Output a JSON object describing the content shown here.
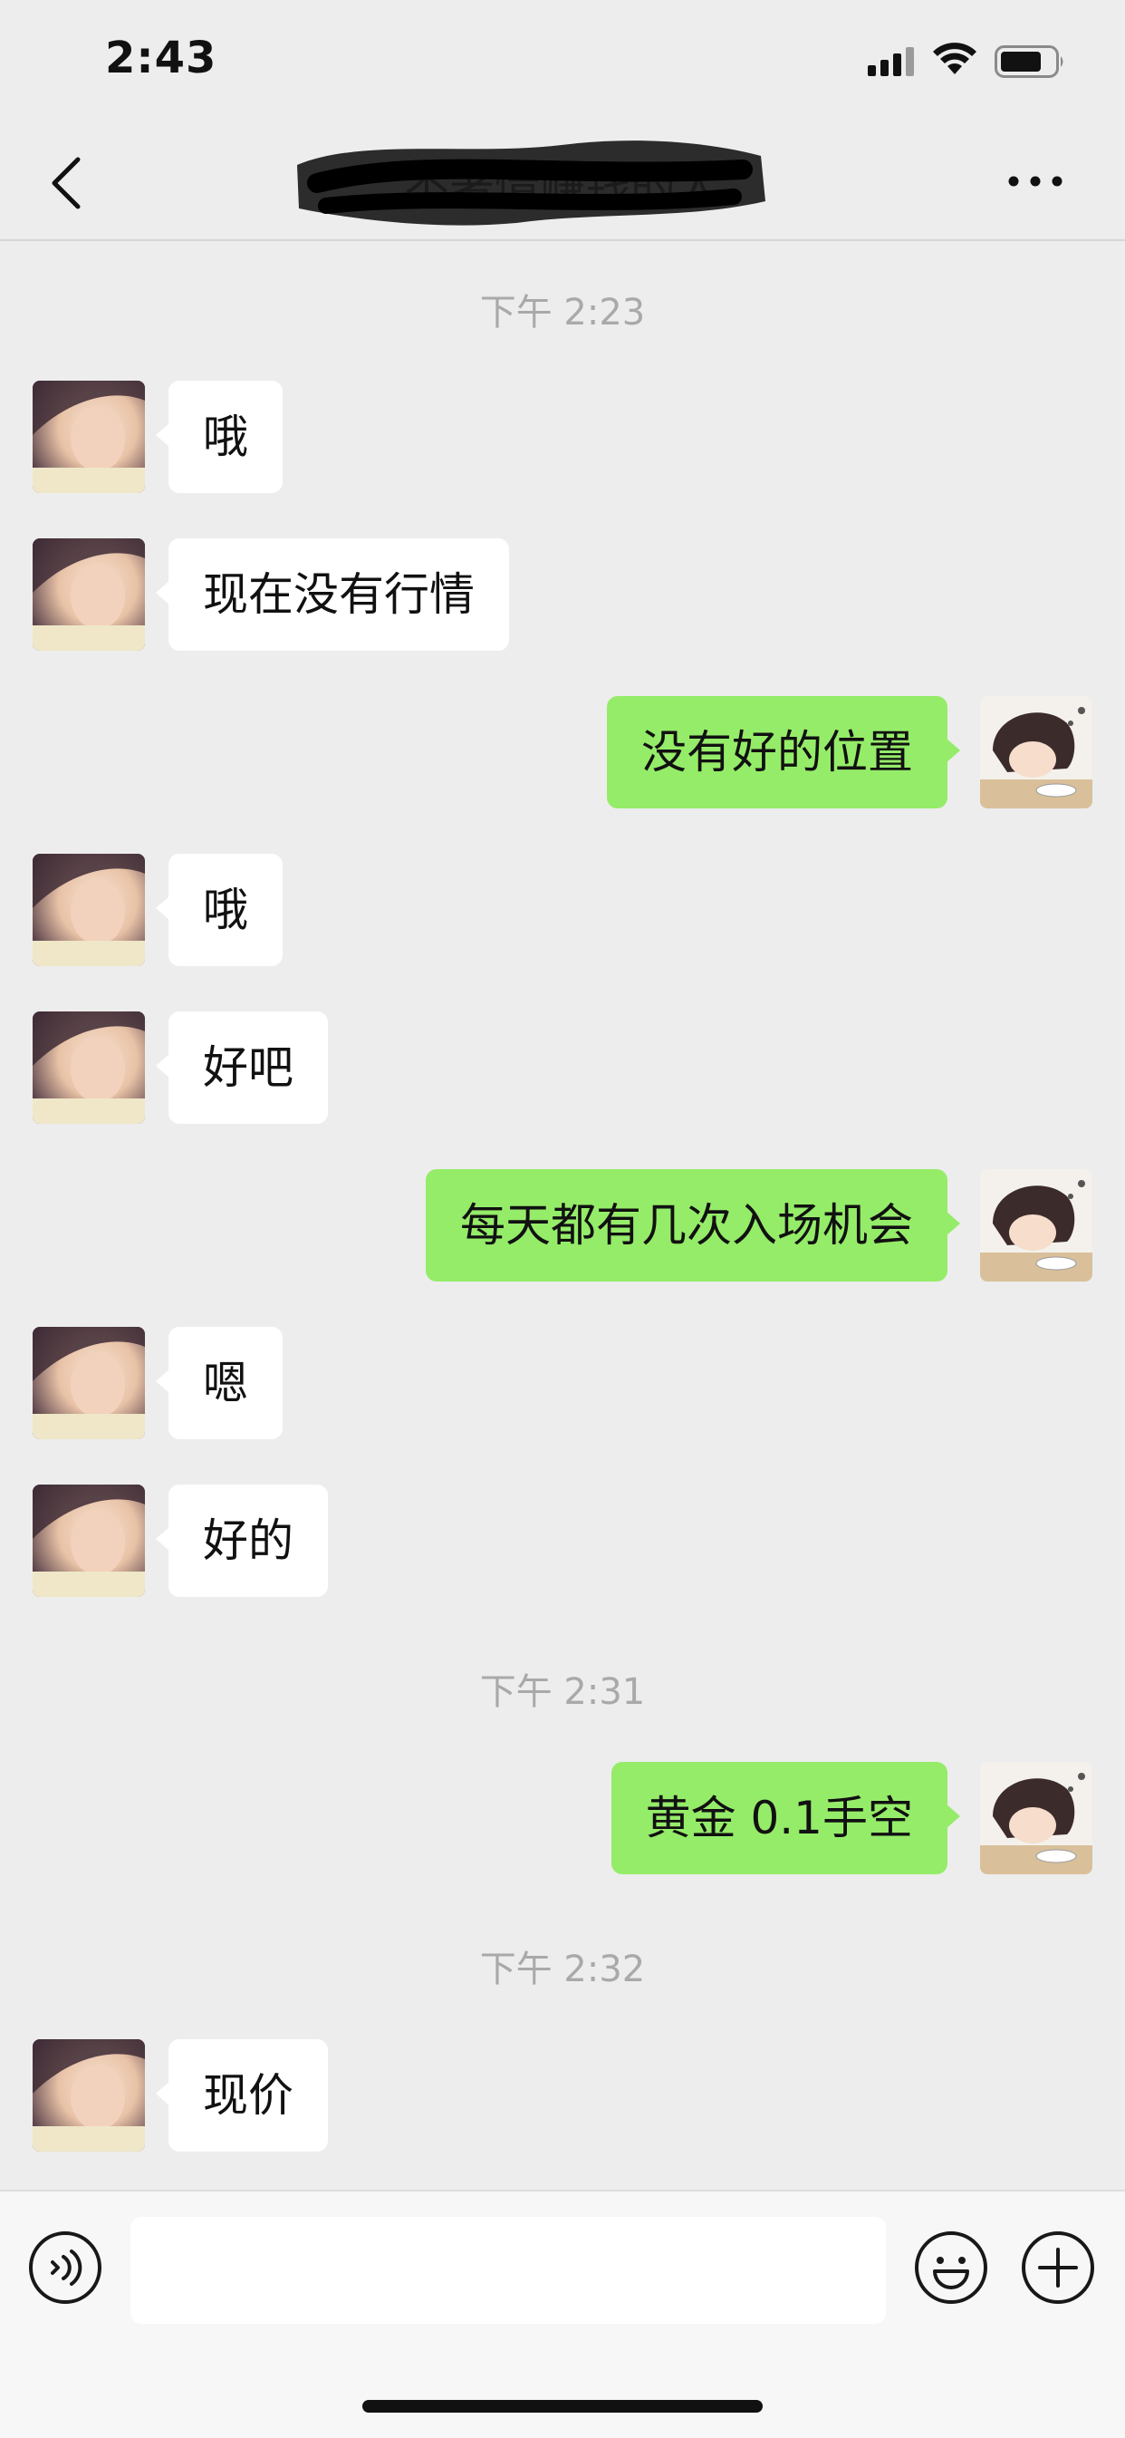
{
  "status_bar": {
    "time": "2:43"
  },
  "header": {
    "title": "不著情赚钱的人"
  },
  "input_bar": {
    "message_value": ""
  },
  "messages": [
    {
      "kind": "timestamp",
      "text": "下午 2:23"
    },
    {
      "kind": "message",
      "side": "in",
      "text": "哦"
    },
    {
      "kind": "message",
      "side": "in",
      "text": "现在没有行情"
    },
    {
      "kind": "message",
      "side": "out",
      "text": "没有好的位置"
    },
    {
      "kind": "message",
      "side": "in",
      "text": "哦"
    },
    {
      "kind": "message",
      "side": "in",
      "text": "好吧"
    },
    {
      "kind": "message",
      "side": "out",
      "text": "每天都有几次入场机会"
    },
    {
      "kind": "message",
      "side": "in",
      "text": "嗯"
    },
    {
      "kind": "message",
      "side": "in",
      "text": "好的"
    },
    {
      "kind": "timestamp",
      "text": "下午 2:31"
    },
    {
      "kind": "message",
      "side": "out",
      "text": "黄金 0.1手空"
    },
    {
      "kind": "timestamp",
      "text": "下午 2:32"
    },
    {
      "kind": "message",
      "side": "in",
      "text": "现价"
    }
  ],
  "colors": {
    "background": "#ededed",
    "incoming_bubble": "#ffffff",
    "outgoing_bubble": "#95ec69",
    "timestamp_text": "#a9a9a9"
  },
  "icons": {
    "back": "chevron-left-icon",
    "more": "more-dots-icon",
    "voice": "voice-icon",
    "emoji": "emoji-icon",
    "plus": "plus-icon"
  }
}
